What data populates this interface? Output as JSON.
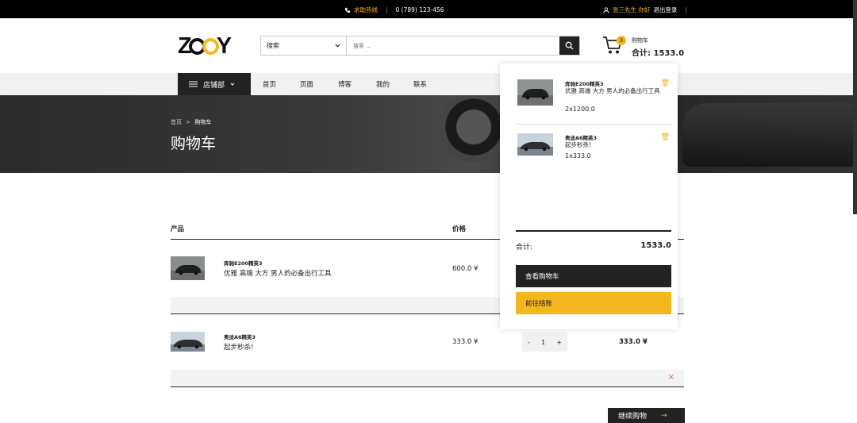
{
  "topbar": {
    "hotline_label": "求助热线",
    "hotline_number": "0 (789) 123-456",
    "user_greeting": "张三先生 你好",
    "logout": "退出登录"
  },
  "logo": {
    "text_left": "Z",
    "text_right": "Y"
  },
  "search": {
    "category": "搜索",
    "placeholder": "搜索 ..."
  },
  "cart": {
    "count": "3",
    "label": "购物车",
    "total": "合计: 1533.0"
  },
  "nav": {
    "store": "店铺部",
    "links": [
      "首页",
      "页面",
      "博客",
      "我的",
      "联系"
    ]
  },
  "hero": {
    "crumb_home": "首页",
    "crumb_sep": ">",
    "crumb_current": "购物车",
    "title": "购物车"
  },
  "table": {
    "col_product": "产品",
    "col_price": "价格",
    "rows": [
      {
        "name": "奔驰E200精英3",
        "desc": "优雅 高端 大方 男人的必备出行工具",
        "price": "600.0 ¥"
      },
      {
        "name": "奥迪A6精英3",
        "desc": "起步秒杀!",
        "price": "333.0 ¥",
        "qty": "1",
        "minus": "-",
        "plus": "+",
        "subtotal": "333.0 ¥"
      }
    ],
    "remove": "×",
    "continue": "继续购物",
    "continue_arrow": "→"
  },
  "minicart": {
    "items": [
      {
        "name": "奔驰E200精英3",
        "desc": "优雅 高端 大方 男人的必备出行工具",
        "qty": "2x1200.0"
      },
      {
        "name": "奥迪A6精英3",
        "desc": "起步秒杀!",
        "qty": "1x333.0"
      }
    ],
    "total_label": "合计:",
    "total_value": "1533.0",
    "view_cart": "查看购物车",
    "checkout": "前往结账"
  },
  "colors": {
    "accent": "#f5b71e",
    "dark": "#222222"
  }
}
